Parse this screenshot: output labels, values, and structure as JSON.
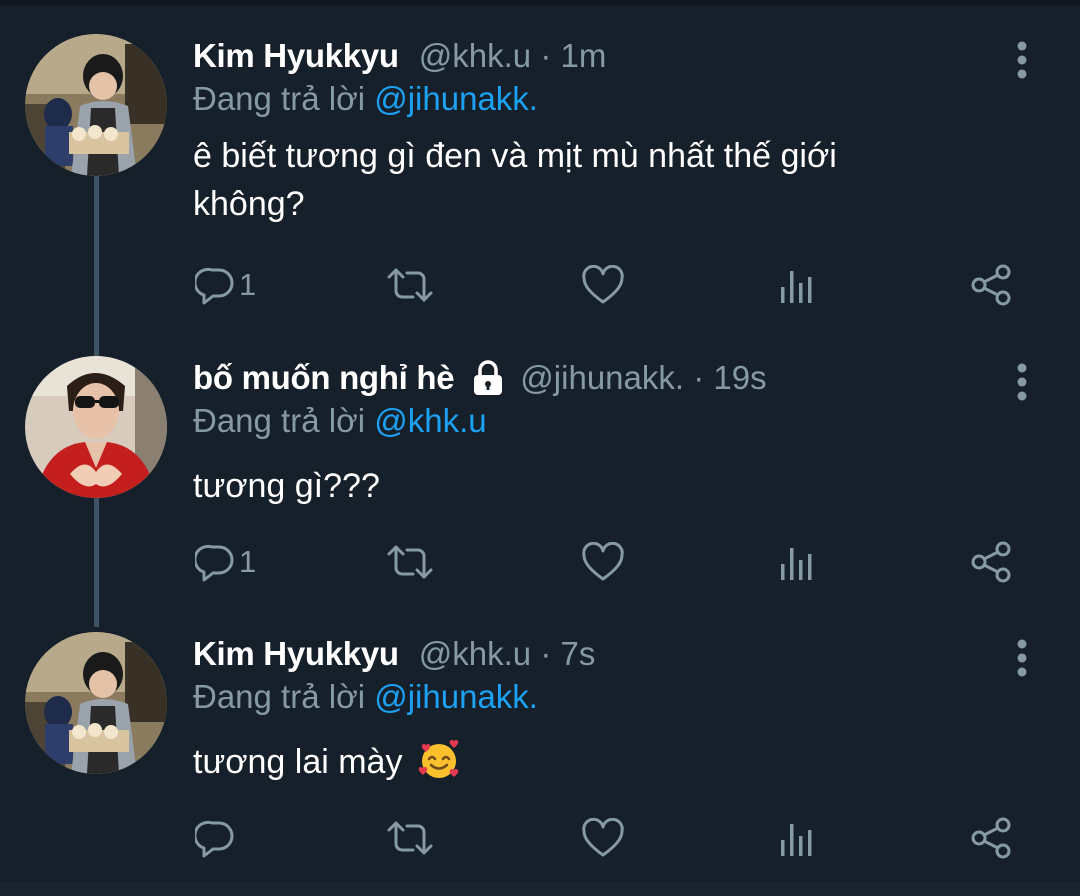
{
  "tweets": [
    {
      "name": "Kim Hyukkyu",
      "handle": "@khk.u",
      "time": "· 1m",
      "reply_prefix": "Đang trả lời",
      "reply_mention": "@jihunakk.",
      "text": "ê biết tương gì đen và mịt mù nhất thế giới không?",
      "reply_count": "1",
      "locked": false,
      "avatar": "avatar-photo"
    },
    {
      "name": "bố muốn nghỉ hè",
      "handle": "@jihunakk.",
      "time": "· 19s",
      "reply_prefix": "Đang trả lời",
      "reply_mention": "@khk.u",
      "text": "tương gì???",
      "reply_count": "1",
      "locked": true,
      "avatar": "avatar-photo"
    },
    {
      "name": "Kim Hyukkyu",
      "handle": "@khk.u",
      "time": "· 7s",
      "reply_prefix": "Đang trả lời",
      "reply_mention": "@jihunakk.",
      "text": "tương lai mày",
      "reply_count": "",
      "locked": false,
      "emoji": "smiling-face-with-hearts",
      "avatar": "avatar-photo"
    }
  ],
  "icons": {
    "reply": "reply-icon",
    "retweet": "retweet-icon",
    "like": "heart-icon",
    "analytics": "analytics-icon",
    "share": "share-icon",
    "more": "more-vertical-icon",
    "lock": "lock-icon"
  },
  "colors": {
    "background": "#15202b",
    "text": "#ffffff",
    "secondary": "#8899a6",
    "link": "#1da1f2",
    "thread_line": "#3d5466"
  }
}
